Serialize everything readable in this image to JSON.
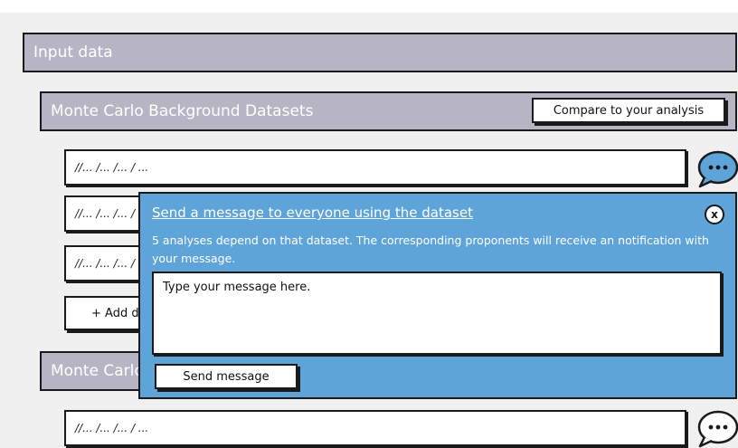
{
  "input_data": {
    "title": "Input data"
  },
  "mc_section": {
    "title": "Monte Carlo Background Datasets",
    "compare_label": "Compare to your analysis",
    "datasets": [
      {
        "path": "//... /... /... / ..."
      },
      {
        "path": "//... /... /... / ..."
      },
      {
        "path": "//... /... /... / ..."
      }
    ],
    "add_label": "+ Add dataset"
  },
  "second_section": {
    "title": "Monte Carlo Signal Datasets",
    "datasets": [
      {
        "path": "//... /... /... / ..."
      }
    ]
  },
  "popup": {
    "title": "Send a message to everyone using the dataset",
    "description": "5 analyses depend on that dataset. The corresponding proponents will receive an notification with your message.",
    "message_placeholder": "Type your message here.",
    "send_label": "Send message",
    "close_label": "x"
  },
  "icons": {
    "chat": "speech-bubble-ellipsis-icon",
    "close": "close-icon"
  },
  "colors": {
    "header_bg": "#b7b4c4",
    "popup_bg": "#5ea4d9",
    "chat_icon_bg": "#5ea4d9",
    "border": "#1a1a1a"
  }
}
